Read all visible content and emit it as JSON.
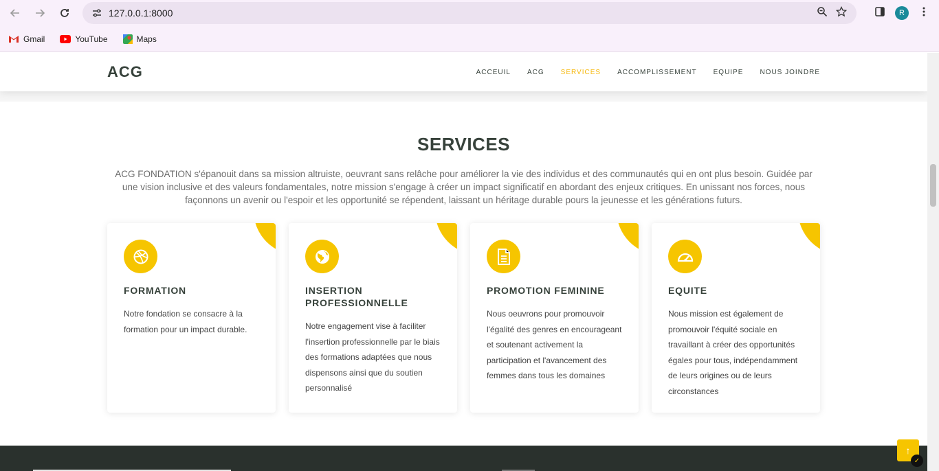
{
  "browser": {
    "url": "127.0.0.1:8000",
    "avatar_letter": "R",
    "bookmarks": [
      {
        "label": "Gmail"
      },
      {
        "label": "YouTube"
      },
      {
        "label": "Maps"
      }
    ]
  },
  "site": {
    "logo": "ACG",
    "menu": [
      {
        "label": "ACCEUIL",
        "active": false
      },
      {
        "label": "ACG",
        "active": false
      },
      {
        "label": "SERVICES",
        "active": true
      },
      {
        "label": "ACCOMPLISSEMENT",
        "active": false
      },
      {
        "label": "EQUIPE",
        "active": false
      },
      {
        "label": "NOUS JOINDRE",
        "active": false
      }
    ]
  },
  "services": {
    "title": "SERVICES",
    "description": "ACG FONDATION s'épanouit dans sa mission altruiste, oeuvrant sans relâche pour améliorer la vie des individus et des communautés qui en ont plus besoin. Guidée par une vision inclusive et des valeurs fondamentales, notre mission s'engage à créer un impact significatif en abordant des enjeux critiques. En unissant nos forces, nous façonnons un avenir ou l'espoir et les opportunité se répendent, laissant un héritage durable pours la jeunesse et les générations futurs.",
    "cards": [
      {
        "icon": "dribbble-icon",
        "title": "FORMATION",
        "text": "Notre fondation se consacre à la formation pour un impact durable."
      },
      {
        "icon": "globe-icon",
        "title": "INSERTION PROFESSIONNELLE",
        "text": "Notre engagement vise à faciliter l'insertion professionnelle par le biais des formations adaptées que nous dispensons ainsi que du soutien personnalisé"
      },
      {
        "icon": "document-icon",
        "title": "PROMOTION FEMININE",
        "text": "Nous oeuvrons pour promouvoir l'égalité des genres en encourageant et soutenant activement la participation et l'avancement des femmes dans tous les domaines"
      },
      {
        "icon": "speedometer-icon",
        "title": "EQUITE",
        "text": "Nous mission est également de promouvoir l'équité sociale en travaillant à créer des opportunités égales pour tous, indépendamment de leurs origines ou de leurs circonstances"
      }
    ]
  },
  "colors": {
    "accent": "#f6c500",
    "active_menu": "#f6b80b",
    "heading": "#37423b",
    "chrome_bg": "#f9f0fb"
  }
}
